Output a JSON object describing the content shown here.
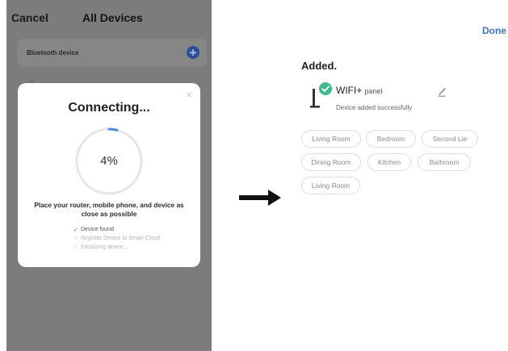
{
  "left_screen": {
    "cancel_label": "Cancel",
    "title": "All Devices",
    "bluetooth_label": "Bluetooth device",
    "modal": {
      "close_glyph": "×",
      "title": "Connecting...",
      "progress_text": "4%",
      "progress_fraction": 0.04,
      "hint": "Place your router, mobile phone, and device as close as possible",
      "steps": [
        {
          "mark": "✓",
          "label": "Device found",
          "done": true
        },
        {
          "mark": "○",
          "label": "Register Device to Smart Cloud",
          "done": false
        },
        {
          "mark": "○",
          "label": "Initializing device...",
          "done": false
        }
      ]
    }
  },
  "right_screen": {
    "done_label": "Done",
    "added_title": "Added.",
    "device": {
      "name": "WIFI+",
      "name_suffix": "panel",
      "status": "Device added successfully"
    },
    "rooms": [
      "Living Room",
      "Bedroom",
      "Second Lie",
      "Dining Room",
      "Kitchen",
      "Bathroom",
      "Living Room"
    ]
  },
  "icons": {
    "add": "plus-circle-icon",
    "close": "close-icon",
    "check": "check-circle-icon",
    "edit": "pencil-icon",
    "device": "floor-lamp-icon",
    "arrow": "arrow-right-icon"
  },
  "colors": {
    "overlay": "#7c7c7c",
    "accent_blue": "#4d88d6",
    "success_green": "#3fba8a",
    "done_blue": "#3f72c0"
  }
}
